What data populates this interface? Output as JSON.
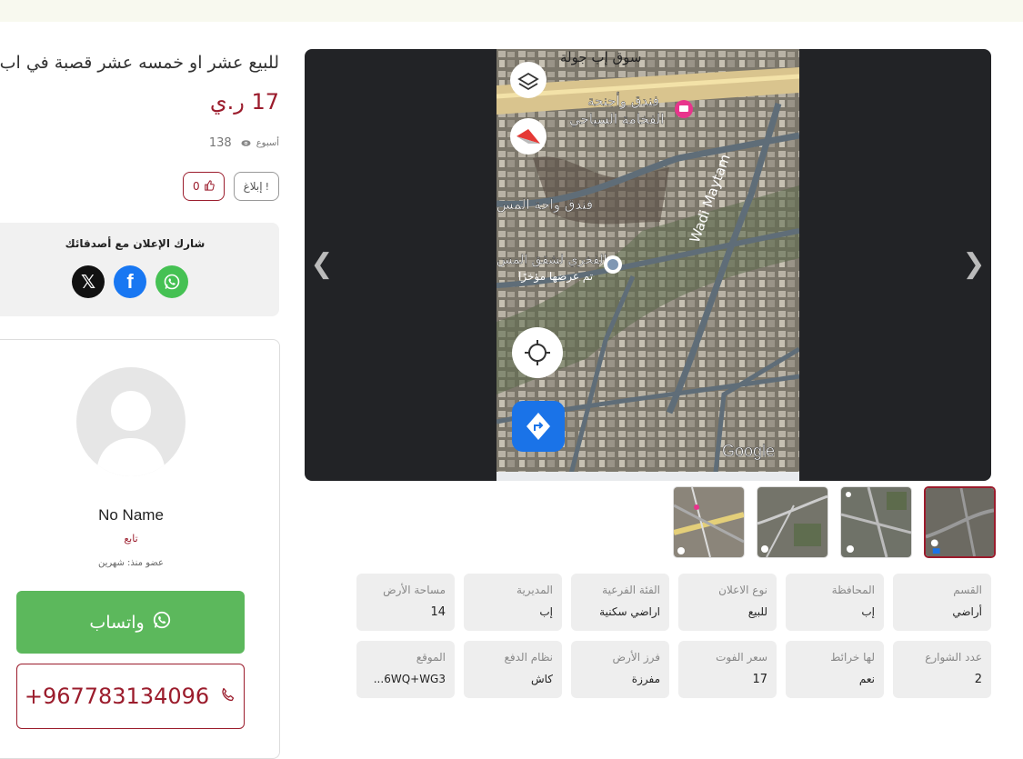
{
  "listing": {
    "title": "للبيع عشر او خمسه عشر قصبة في اب",
    "price": "17 ر.ي",
    "posted": "أسبوع",
    "views": "138",
    "report_label": "إبلاغ",
    "likes": "0"
  },
  "share": {
    "title": "شارك الإعلان مع أصدقائك",
    "x_icon": "x-icon",
    "facebook_icon": "facebook-icon",
    "whatsapp_icon": "whatsapp-icon"
  },
  "seller": {
    "name": "No Name",
    "role": "تابع",
    "member_since": "عضو منذ: شهرين",
    "whatsapp_label": "واتساب",
    "phone": "+967783134096"
  },
  "gallery": {
    "map_labels": {
      "top_label": "سوق إب جولة",
      "hotel1_line1": "فندق وأجنحة",
      "hotel1_line2": "الفخامة السياحي",
      "hotel2": "فندق واحة المس",
      "place_line1": "الفخري لشقق المس",
      "place_line2": "تم عرضها مؤخرًا",
      "road": "Wadi Maytam",
      "brand": "Google"
    },
    "thumb_count": 4,
    "active_thumb": 4
  },
  "details": [
    {
      "label": "القسم",
      "value": "أراضي"
    },
    {
      "label": "المحافظة",
      "value": "إب"
    },
    {
      "label": "نوع الاعلان",
      "value": "للبيع"
    },
    {
      "label": "الفئة الفرعية",
      "value": "اراضي سكنية"
    },
    {
      "label": "المديرية",
      "value": "إب"
    },
    {
      "label": "مساحة الأرض",
      "value": "14"
    },
    {
      "label": "عدد الشوارع",
      "value": "2"
    },
    {
      "label": "لها خرائط",
      "value": "نعم"
    },
    {
      "label": "سعر الفوت",
      "value": "17"
    },
    {
      "label": "فرز الأرض",
      "value": "مفرزة"
    },
    {
      "label": "نظام الدفع",
      "value": "كاش"
    },
    {
      "label": "الموقع",
      "value": "6WQ+WG3..."
    }
  ],
  "colors": {
    "accent": "#9b1c2c",
    "whatsapp": "#5cb85c",
    "facebook": "#1877f2",
    "cell_bg": "#eeeeee"
  }
}
